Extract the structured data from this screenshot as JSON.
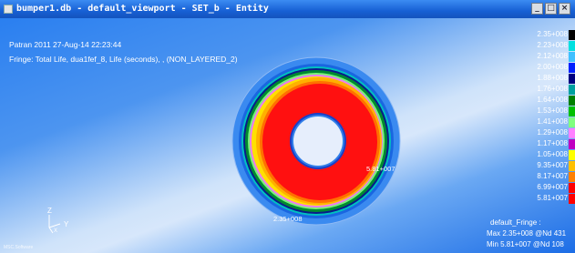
{
  "window": {
    "title": "bumper1.db - default_viewport - SET_b - Entity",
    "controls": [
      "_",
      "□",
      "×"
    ]
  },
  "viewport": {
    "header_line1": "Patran 2011 27-Aug-14 22:23:44",
    "header_line2": "Fringe: Total Life, dua1fef_8, Life (seconds), , (NON_LAYERED_2)",
    "axis_x": "Y",
    "axis_z": "Z",
    "axis_origin": "X",
    "corner_logo": "MSC.Software",
    "max_node_label": "5.81+007",
    "min_node_label": "2.35+008",
    "fringe_name": "default_Fringe :",
    "max_line": "Max 2.35+008 @Nd 431",
    "min_line": "Min 5.81+007 @Nd 108"
  },
  "legend": [
    {
      "label": "2.35+008",
      "color": "#000000"
    },
    {
      "label": "2.23+008",
      "color": "#00e0e0"
    },
    {
      "label": "2.12+008",
      "color": "#40c0ff"
    },
    {
      "label": "2.00+008",
      "color": "#0020ff"
    },
    {
      "label": "1.88+008",
      "color": "#000080"
    },
    {
      "label": "1.76+008",
      "color": "#00a0a0"
    },
    {
      "label": "1.64+008",
      "color": "#008000"
    },
    {
      "label": "1.53+008",
      "color": "#00c000"
    },
    {
      "label": "1.41+008",
      "color": "#80ff80"
    },
    {
      "label": "1.29+008",
      "color": "#ff80ff"
    },
    {
      "label": "1.17+008",
      "color": "#c000c0"
    },
    {
      "label": "1.05+008",
      "color": "#ffff00"
    },
    {
      "label": "9.35+007",
      "color": "#ffc000"
    },
    {
      "label": "8.17+007",
      "color": "#ff8000"
    },
    {
      "label": "6.99+007",
      "color": "#ff0000"
    },
    {
      "label": "5.81+007",
      "color": "#ff0000"
    }
  ]
}
